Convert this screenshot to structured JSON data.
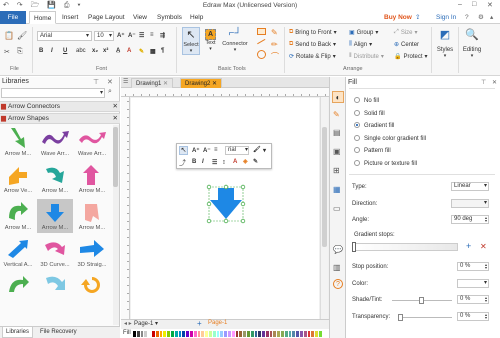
{
  "window": {
    "title": "Edraw Max (Unlicensed Version)"
  },
  "menu": {
    "file": "File",
    "items": [
      "Home",
      "Insert",
      "Page Layout",
      "View",
      "Symbols",
      "Help"
    ],
    "buy_now": "Buy Now",
    "sign_in": "Sign In"
  },
  "ribbon": {
    "font_name": "Arial",
    "font_size": "10",
    "groups": {
      "file": "File",
      "font": "Font",
      "basic_tools": "Basic Tools",
      "arrange": "Arrange"
    },
    "select": "Select",
    "text": "Text",
    "connector": "Connector",
    "bring_to_front": "Bring to Front",
    "send_to_back": "Send to Back",
    "rotate_flip": "Rotate & Flip",
    "group": "Group",
    "align": "Align",
    "distribute": "Distribute",
    "size": "Size",
    "center": "Center",
    "protect": "Protect",
    "styles": "Styles",
    "editing": "Editing"
  },
  "libraries": {
    "title": "Libraries",
    "categories": [
      "Arrow Connectors",
      "Arrow Shapes"
    ],
    "shapes": [
      {
        "label": "Arrow M..."
      },
      {
        "label": "Wave Arr..."
      },
      {
        "label": "Wave Arr..."
      },
      {
        "label": "Arrow Ve..."
      },
      {
        "label": "Arrow M..."
      },
      {
        "label": "Arrow M..."
      },
      {
        "label": "Arrow M..."
      },
      {
        "label": "Arrow M..."
      },
      {
        "label": "Arrow M..."
      },
      {
        "label": "Vertical A..."
      },
      {
        "label": "3D Curve..."
      },
      {
        "label": "3D Straig..."
      }
    ],
    "tabs": [
      "Libraries",
      "File Recovery"
    ]
  },
  "documents": {
    "tabs": [
      "Drawing1",
      "Drawing2"
    ]
  },
  "floating_toolbar": {
    "font": "rial"
  },
  "page_tabs": {
    "current": "Page-1",
    "active": "Page-1"
  },
  "status": {
    "fill_label": "Fill"
  },
  "fill_panel": {
    "title": "Fill",
    "options": [
      "No fill",
      "Solid fill",
      "Gradient fill",
      "Single color gradient fill",
      "Pattern fill",
      "Picture or texture fill"
    ],
    "selected_option": "Gradient fill",
    "type_label": "Type:",
    "type_value": "Linear",
    "direction_label": "Direction:",
    "angle_label": "Angle:",
    "angle_value": "90 deg",
    "gradient_stops_label": "Gradient stops:",
    "stop_position_label": "Stop position:",
    "stop_position_value": "0 %",
    "color_label": "Color:",
    "shade_label": "Shade/Tint:",
    "shade_value": "0 %",
    "transparency_label": "Transparency:",
    "transparency_value": "0 %"
  },
  "colors": {
    "accent": "#2b6cb8",
    "shape_blue": "#1e88e5",
    "buy_now": "#e0541a"
  }
}
